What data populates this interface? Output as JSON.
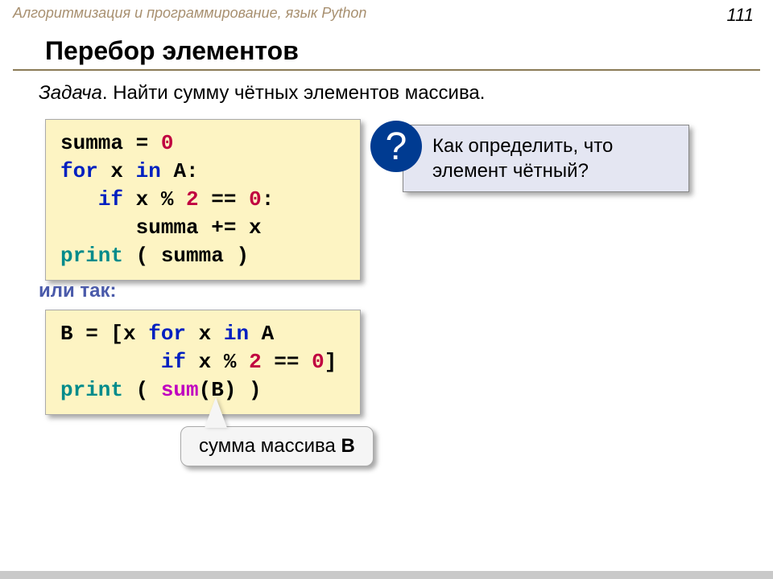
{
  "header": "Алгоритмизация и программирование, язык Python",
  "page_num": "111",
  "title": "Перебор элементов",
  "task_label": "Задача",
  "task_text": ". Найти сумму чётных элементов массива.",
  "code1": {
    "l1_a": "summa = ",
    "l1_b": "0",
    "l2_a": "for",
    "l2_b": " x ",
    "l2_c": "in",
    "l2_d": " A:",
    "l3_a": "   ",
    "l3_b": "if",
    "l3_c": " x % ",
    "l3_d": "2",
    "l3_e": " == ",
    "l3_f": "0",
    "l3_g": ":",
    "l4": "      summa += x",
    "l5_a": "print",
    "l5_b": " ( summa )"
  },
  "question_mark": "?",
  "question_text_l1": "Как определить, что",
  "question_text_l2": "элемент чётный?",
  "or_so": "или так:",
  "code2": {
    "l1_a": "B = [x ",
    "l1_b": "for",
    "l1_c": " x ",
    "l1_d": "in",
    "l1_e": " A",
    "l2_a": "        ",
    "l2_b": "if",
    "l2_c": " x % ",
    "l2_d": "2",
    "l2_e": " == ",
    "l2_f": "0",
    "l2_g": "]",
    "l3_a": "print",
    "l3_b": " ( ",
    "l3_c": "sum",
    "l3_d": "(B) )"
  },
  "callout_a": "сумма массива ",
  "callout_b": "B"
}
